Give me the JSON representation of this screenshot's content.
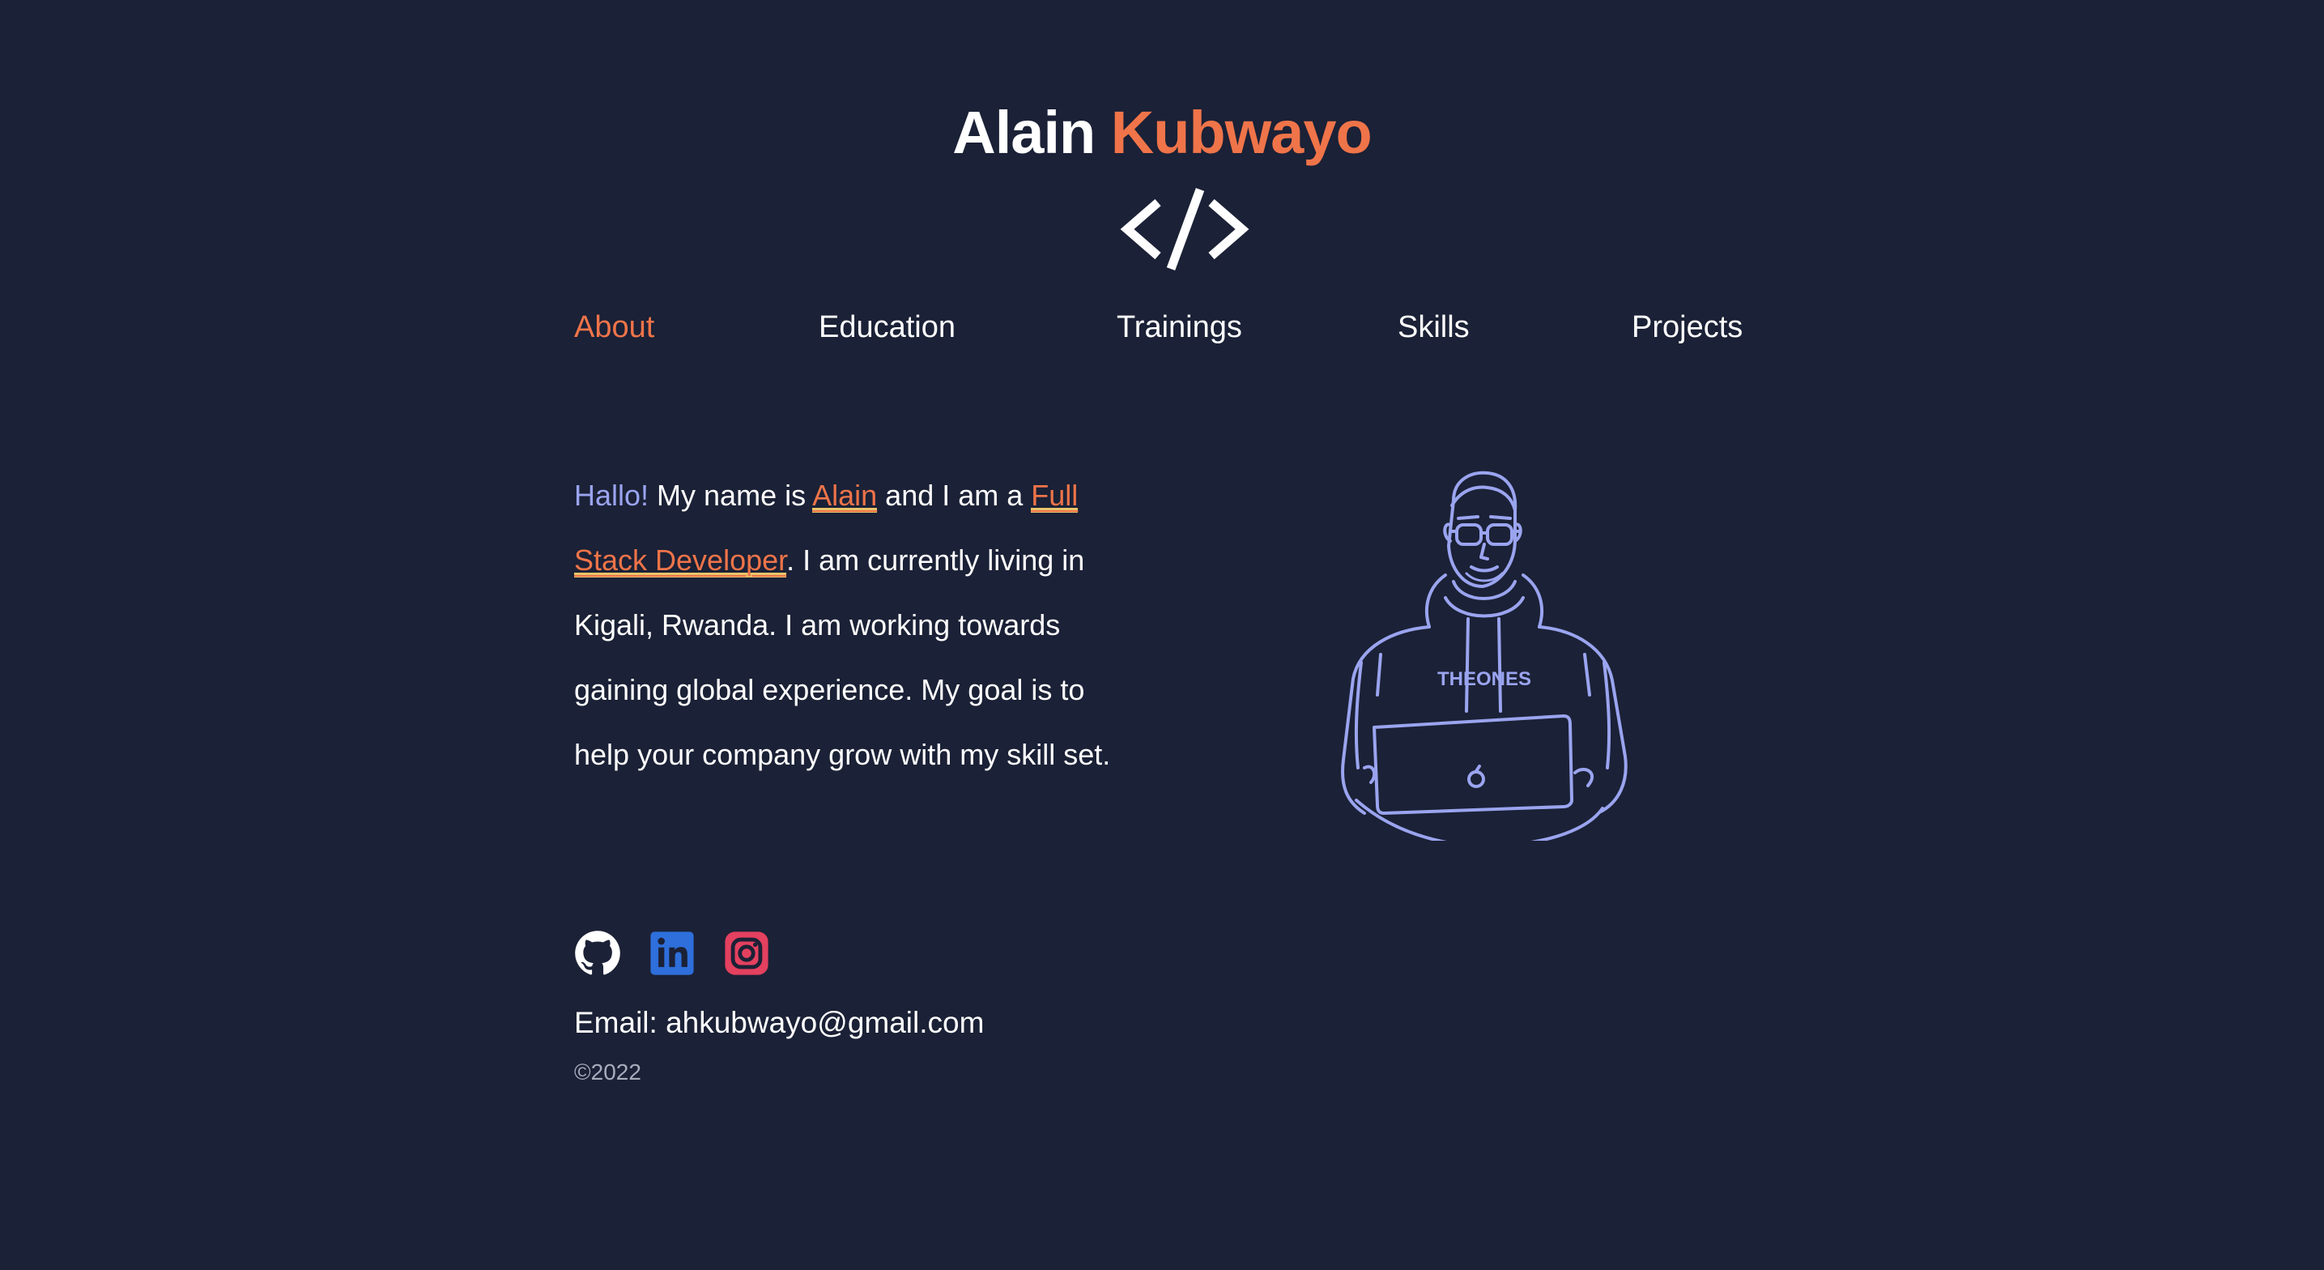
{
  "header": {
    "first_name": "Alain",
    "last_name": "Kubwayo",
    "logo_icon": "code-brackets-icon",
    "logo_text": "</>"
  },
  "nav": {
    "items": [
      {
        "label": "About",
        "active": true
      },
      {
        "label": "Education",
        "active": false
      },
      {
        "label": "Trainings",
        "active": false
      },
      {
        "label": "Skills",
        "active": false
      },
      {
        "label": "Projects",
        "active": false
      }
    ]
  },
  "intro": {
    "greeting": "Hallo!",
    "text1": " My name is ",
    "name": "Alain",
    "text2": " and I am a ",
    "role": "Full Stack Developer",
    "text3": ". I am currently living in Kigali, Rwanda. I am working towards gaining global experience. My goal is to help your company grow with my skill set."
  },
  "portrait": {
    "icon": "developer-portrait-illustration",
    "shirt_text": "THEONES"
  },
  "socials": [
    {
      "name": "github-icon"
    },
    {
      "name": "linkedin-icon"
    },
    {
      "name": "instagram-icon"
    }
  ],
  "contact": {
    "email_label": "Email: ",
    "email": "ahkubwayo@gmail.com"
  },
  "footer": {
    "copyright": "©2022"
  },
  "colors": {
    "background": "#1b2136",
    "accent": "#ef7449",
    "highlight": "#e9c46a",
    "lavender": "#9aa4ef",
    "linkedin": "#2e6fdc",
    "instagram": "#e4405f"
  }
}
